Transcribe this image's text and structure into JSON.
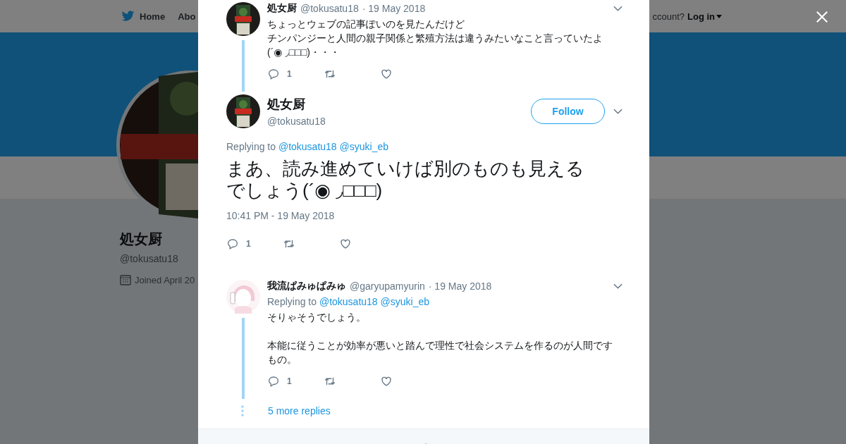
{
  "background_page": {
    "nav": [
      {
        "label": "Home",
        "kind": "home"
      },
      {
        "label": "Abo",
        "kind": "plain"
      }
    ],
    "account_prompt": "ccount?",
    "login": "Log in",
    "profile": {
      "name": "処女厨",
      "handle": "@tokusatu18",
      "joined": "Joined April 20"
    }
  },
  "modal": {
    "tweets": [
      {
        "kind": "reply",
        "name": "処女厨",
        "handle": "@tokusatu18",
        "date": "· 19 May 2018",
        "lines": [
          "ちょっとウェブの記事ぽいのを見たんだけど",
          "チンパンジーと人間の親子関係と繁殖方法は違うみたいなこと言っていたよ",
          "(´◉ ◞□□□)・・・"
        ],
        "reply_count": "1",
        "thread_line": true
      },
      {
        "kind": "focused",
        "name": "処女厨",
        "handle": "@tokusatu18",
        "follow": "Follow",
        "replying_label": "Replying to",
        "replying_to": [
          "@tokusatu18",
          "@syuki_eb"
        ],
        "lines": [
          "まあ、読み進めていけば別のものも見えるでしょう(´◉ ◞□□□)"
        ],
        "time": "10:41 PM - 19 May 2018",
        "reply_count": "1"
      },
      {
        "kind": "reply",
        "name": "我流ぱみゅぱみゅ",
        "handle": "@garyupamyurin",
        "date": "· 19 May 2018",
        "replying_label": "Replying to",
        "replying_to": [
          "@tokusatu18",
          "@syuki_eb"
        ],
        "lines": [
          "そりゃそうでしょう。",
          "本能に従うことが効率が悪いと踏んで理性で社会システムを作るのが人間ですもの。"
        ],
        "reply_count": "1",
        "thread_line": true
      }
    ],
    "more_replies": "5 more replies"
  }
}
